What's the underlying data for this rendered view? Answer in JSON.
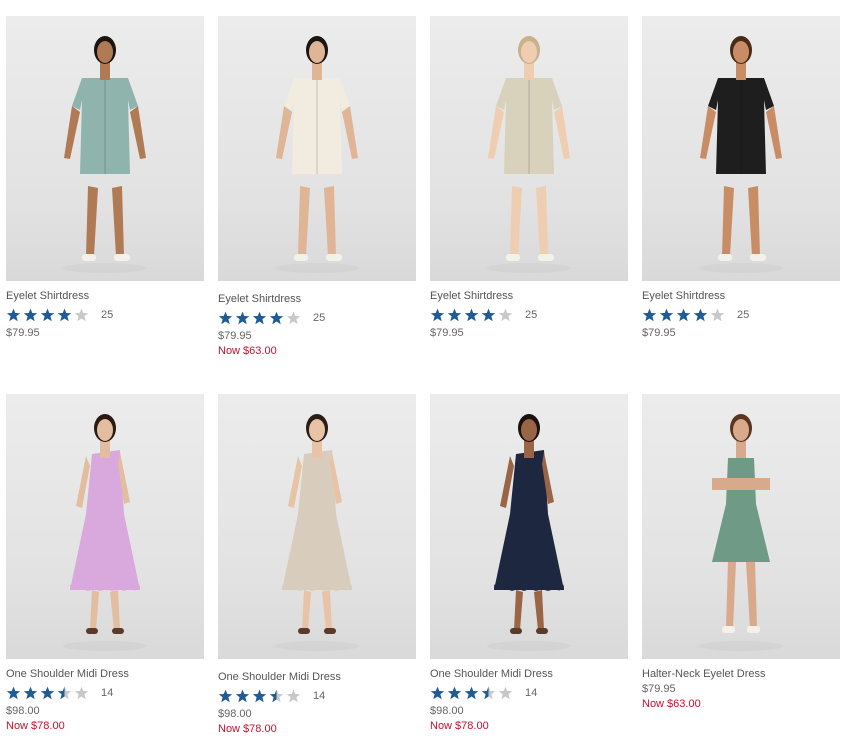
{
  "colors": {
    "star": "#1f5b96",
    "star_empty": "#c8c8c8",
    "sale": "#c8102e"
  },
  "products": [
    {
      "name": "Eyelet Shirtdress",
      "rating": 4,
      "reviews": "25",
      "price": "$79.95",
      "sale": "",
      "dress_color": "#8fb3ad",
      "style": "shirt"
    },
    {
      "name": "Eyelet Shirtdress",
      "rating": 4,
      "reviews": "25",
      "price": "$79.95",
      "sale": "Now $63.00",
      "dress_color": "#f1ebe0",
      "style": "shirt"
    },
    {
      "name": "Eyelet Shirtdress",
      "rating": 4,
      "reviews": "25",
      "price": "$79.95",
      "sale": "",
      "dress_color": "#d8d2bd",
      "style": "shirt"
    },
    {
      "name": "Eyelet Shirtdress",
      "rating": 4,
      "reviews": "25",
      "price": "$79.95",
      "sale": "",
      "dress_color": "#1e1e1e",
      "style": "shirt"
    },
    {
      "name": "One Shoulder Midi Dress",
      "rating": 3.5,
      "reviews": "14",
      "price": "$98.00",
      "sale": "Now $78.00",
      "dress_color": "#d9a9dd",
      "style": "midi"
    },
    {
      "name": "One Shoulder Midi Dress",
      "rating": 3.5,
      "reviews": "14",
      "price": "$98.00",
      "sale": "Now $78.00",
      "dress_color": "#d8cdbd",
      "style": "midi"
    },
    {
      "name": "One Shoulder Midi Dress",
      "rating": 3.5,
      "reviews": "14",
      "price": "$98.00",
      "sale": "Now $78.00",
      "dress_color": "#1d2740",
      "style": "midi"
    },
    {
      "name": "Halter-Neck Eyelet Dress",
      "rating": 0,
      "reviews": "",
      "price": "$79.95",
      "sale": "Now $63.00",
      "dress_color": "#6f9a86",
      "style": "halter"
    }
  ]
}
